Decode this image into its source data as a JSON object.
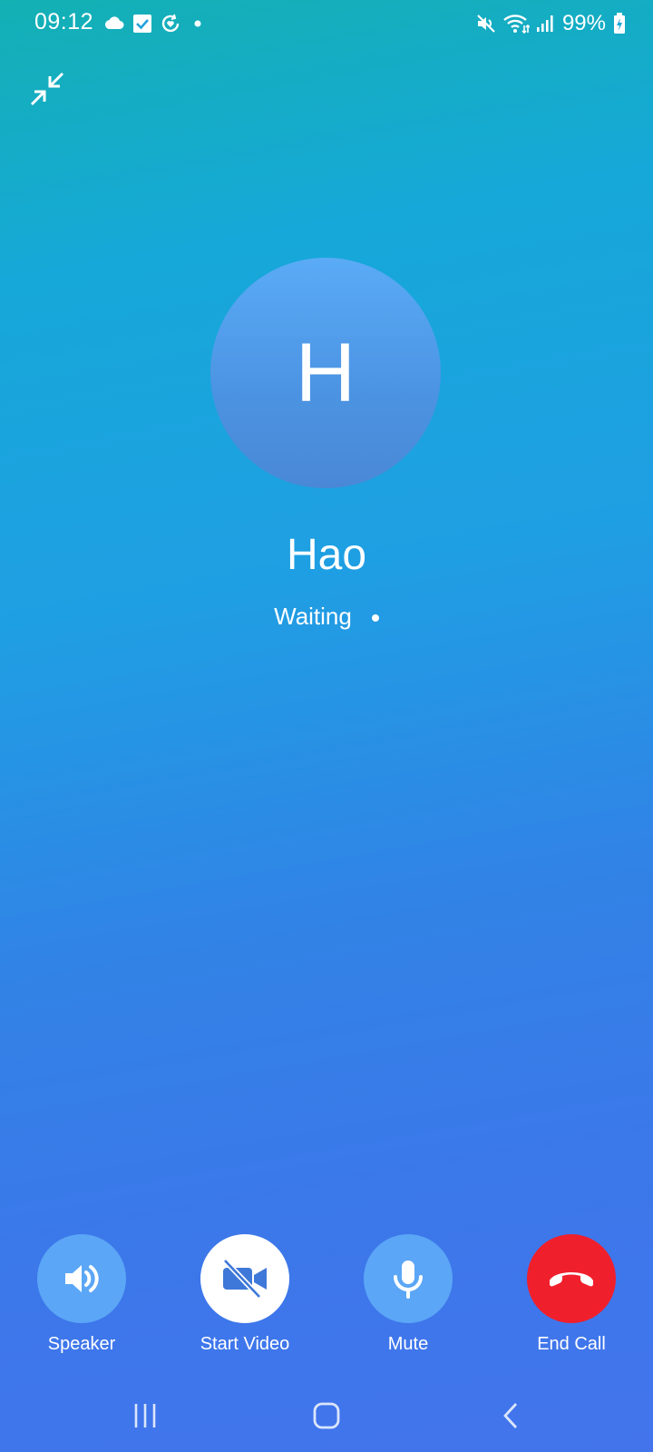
{
  "status_bar": {
    "time": "09:12",
    "left_icons": [
      "cloud-icon",
      "checkbox-icon",
      "heart-sync-icon",
      "dot-icon"
    ],
    "right_icons": [
      "mute-icon",
      "wifi-icon",
      "signal-icon"
    ],
    "battery": "99%"
  },
  "caller": {
    "initial": "H",
    "name": "Hao",
    "status": "Waiting"
  },
  "controls": [
    {
      "label": "Speaker",
      "icon": "speaker-icon",
      "bg": "#5ba6f6"
    },
    {
      "label": "Start Video",
      "icon": "video-off-icon",
      "bg": "#ffffff"
    },
    {
      "label": "Mute",
      "icon": "microphone-icon",
      "bg": "#5ba6f6"
    },
    {
      "label": "End Call",
      "icon": "phone-hangup-icon",
      "bg": "#f01f2c"
    }
  ],
  "nav": [
    "recents-icon",
    "home-icon",
    "back-icon"
  ],
  "colors": {
    "end_call": "#f01f2c",
    "control_bg": "#5ba6f6",
    "video_icon": "#3e78d8"
  }
}
